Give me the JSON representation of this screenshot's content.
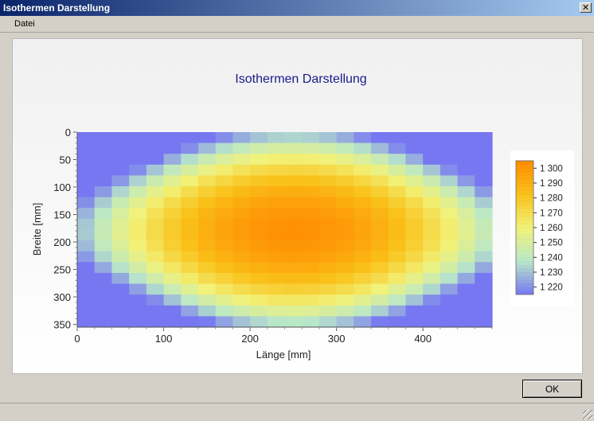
{
  "window": {
    "title": "Isothermen Darstellung",
    "close_glyph": "✕"
  },
  "menu": {
    "items": [
      {
        "label": "Datei"
      }
    ]
  },
  "buttons": {
    "ok_label": "OK"
  },
  "chart_data": {
    "type": "heatmap",
    "title": "Isothermen Darstellung",
    "xlabel": "Länge [mm]",
    "ylabel": "Breite [mm]",
    "xlim": [
      0,
      480
    ],
    "ylim": [
      0,
      355
    ],
    "y_inverted": true,
    "x_ticks": [
      0,
      100,
      200,
      300,
      400
    ],
    "y_ticks": [
      0,
      50,
      100,
      150,
      200,
      250,
      300,
      350
    ],
    "grid": {
      "nx": 24,
      "ny": 18
    },
    "center": [
      250,
      180
    ],
    "value_max": 1303,
    "value_min": 1212,
    "colorbar": {
      "min": 1215,
      "max": 1305,
      "ticks": [
        1220,
        1230,
        1240,
        1250,
        1260,
        1270,
        1280,
        1290,
        1300
      ],
      "tick_labels": [
        "1 220",
        "1 230",
        "1 240",
        "1 250",
        "1 260",
        "1 270",
        "1 280",
        "1 290",
        "1 300"
      ]
    },
    "colors": {
      "low": "#7777f2",
      "mid_low": "#b9e8c8",
      "mid": "#f2f279",
      "mid_high": "#f9c21a",
      "high": "#ff8c00"
    }
  }
}
